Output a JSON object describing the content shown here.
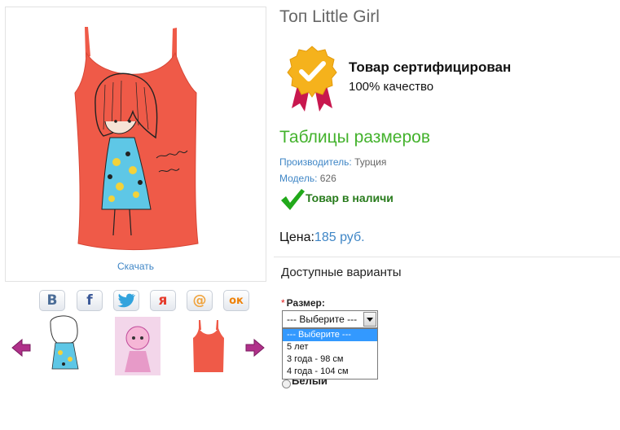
{
  "product": {
    "title": "Топ Little Girl",
    "download_label": "Скачать",
    "cert_title": "Товар сертифицирован",
    "cert_subtitle": "100% качество",
    "size_chart_label": "Таблицы размеров",
    "manufacturer_label": "Производитель:",
    "manufacturer_value": "Турция",
    "model_label": "Модель:",
    "model_value": "626",
    "stock_status": "Товар в наличи",
    "price_label": "Цена:",
    "price_value": "185 руб."
  },
  "share": {
    "buttons": [
      {
        "name": "vk-share-button",
        "glyph": "B",
        "color": "#4a6c97"
      },
      {
        "name": "facebook-share-button",
        "glyph": "f",
        "color": "#3b5998"
      },
      {
        "name": "twitter-share-button",
        "glyph": "🐦",
        "color": "#32a3dd"
      },
      {
        "name": "moikrug-share-button",
        "glyph": "я",
        "color": "#e53b2c"
      },
      {
        "name": "mailru-share-button",
        "glyph": "@",
        "color": "#f0a23b"
      },
      {
        "name": "odnoklassniki-share-button",
        "glyph": "ок",
        "color": "#ee8208"
      }
    ]
  },
  "options": {
    "heading": "Доступные варианты",
    "size_label": "Размер:",
    "required_mark": "*",
    "selected_value": "--- Выберите ---",
    "dropdown_items": [
      "--- Выберите ---",
      "5 лет",
      "3 года - 98 см",
      "4 года - 104 см"
    ],
    "color_option": "Белый"
  },
  "colors": {
    "accent_green": "#43b22c",
    "link_blue": "#3f86c6",
    "stock_green": "#287b1c",
    "shirt_coral": "#ef5a48",
    "nav_arrow_purple": "#b0308a"
  }
}
